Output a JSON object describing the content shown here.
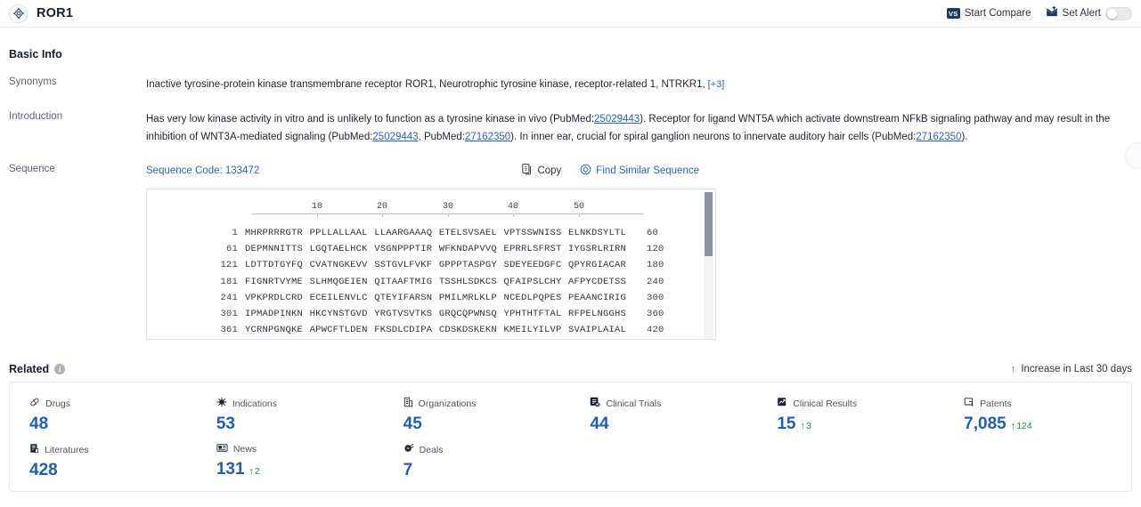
{
  "header": {
    "title": "ROR1",
    "icon": "target-icon",
    "actions": {
      "compare_label": "Start Compare",
      "compare_badge": "VS",
      "alert_label": "Set Alert",
      "alert_toggle_state": "off"
    }
  },
  "basic_info": {
    "section_title": "Basic Info",
    "rows": [
      {
        "label": "Synonyms"
      },
      {
        "label": "Introduction"
      },
      {
        "label": "Sequence"
      }
    ],
    "synonyms": {
      "text": "Inactive tyrosine-protein kinase transmembrane receptor ROR1,  Neurotrophic tyrosine kinase, receptor-related 1,  NTRKR1,",
      "more": "[+3]"
    },
    "introduction": {
      "p1": "Has very low kinase activity in vitro and is unlikely to function as a tyrosine kinase in vivo (PubMed:",
      "ref1": "25029443",
      "p2": "). Receptor for ligand WNT5A which activate downstream NFkB signaling pathway and may result in the inhibition of WNT3A-mediated signaling (PubMed:",
      "ref2": "25029443",
      "p3": ", PubMed:",
      "ref3": "27162350",
      "p4": "). In inner ear, crucial for spiral ganglion neurons to innervate auditory hair cells (PubMed:",
      "ref4": "27162350",
      "p5": ")."
    }
  },
  "sequence": {
    "code_label": "Sequence Code: 133472",
    "copy_label": "Copy",
    "find_similar_label": "Find Similar Sequence",
    "ruler_ticks": [
      "10",
      "20",
      "30",
      "40",
      "50"
    ],
    "lines": [
      {
        "start": "1",
        "chunks": [
          "MHRPRRRGTR",
          "PPLLALLAAL",
          "LLAARGAAAQ",
          "ETELSVSAEL",
          "VPTSSWNISS",
          "ELNKDSYLTL"
        ],
        "end": "60"
      },
      {
        "start": "61",
        "chunks": [
          "DEPMNNITTS",
          "LGQTAELHCK",
          "VSGNPPPTIR",
          "WFKNDAPVVQ",
          "EPRRLSFRST",
          "IYGSRLRIRN"
        ],
        "end": "120"
      },
      {
        "start": "121",
        "chunks": [
          "LDTTDTGYFQ",
          "CVATNGKEVV",
          "SSTGVLFVKF",
          "GPPPTASPGY",
          "SDEYEEDGFC",
          "QPYRGIACAR"
        ],
        "end": "180"
      },
      {
        "start": "181",
        "chunks": [
          "FIGNRTVYME",
          "SLHMQGEIEN",
          "QITAAFTMIG",
          "TSSHLSDKCS",
          "QFAIPSLCHY",
          "AFPYCDETSS"
        ],
        "end": "240"
      },
      {
        "start": "241",
        "chunks": [
          "VPKPRDLCRD",
          "ECEILENVLC",
          "QTEYIFARSN",
          "PMILMRLKLP",
          "NCEDLPQPES",
          "PEAANCIRIG"
        ],
        "end": "300"
      },
      {
        "start": "301",
        "chunks": [
          "IPMADPINKN",
          "HKCYNSTGVD",
          "YRGTVSVTKS",
          "GRQCQPWNSQ",
          "YPHTHTFTAL",
          "RFPELNGGHS"
        ],
        "end": "360"
      },
      {
        "start": "361",
        "chunks": [
          "YCRNPGNQKE",
          "APWCFTLDEN",
          "FKSDLCDIPA",
          "CDSKDSKEKN",
          "KMEILYILVP",
          "SVAIPLAIAL"
        ],
        "end": "420"
      }
    ]
  },
  "related": {
    "title": "Related",
    "info_glyph": "i",
    "legend": "Increase in Last 30 days",
    "legend_arrow": "↑",
    "items": [
      {
        "icon": "pill-icon",
        "label": "Drugs",
        "value": "48",
        "delta": ""
      },
      {
        "icon": "virus-icon",
        "label": "Indications",
        "value": "53",
        "delta": ""
      },
      {
        "icon": "building-icon",
        "label": "Organizations",
        "value": "45",
        "delta": ""
      },
      {
        "icon": "clinical-trial-icon",
        "label": "Clinical Trials",
        "value": "44",
        "delta": ""
      },
      {
        "icon": "clinical-result-icon",
        "label": "Clinical Results",
        "value": "15",
        "delta": "3"
      },
      {
        "icon": "patent-icon",
        "label": "Patents",
        "value": "7,085",
        "delta": "124"
      },
      {
        "icon": "literature-icon",
        "label": "Literatures",
        "value": "428",
        "delta": ""
      },
      {
        "icon": "news-icon",
        "label": "News",
        "value": "131",
        "delta": "2"
      },
      {
        "icon": "deal-icon",
        "label": "Deals",
        "value": "7",
        "delta": ""
      }
    ]
  },
  "colors": {
    "accent_blue": "#1f5fb0",
    "link_blue": "#2f63b5",
    "increase_green": "#1a8f3c",
    "navy": "#1f3864"
  }
}
